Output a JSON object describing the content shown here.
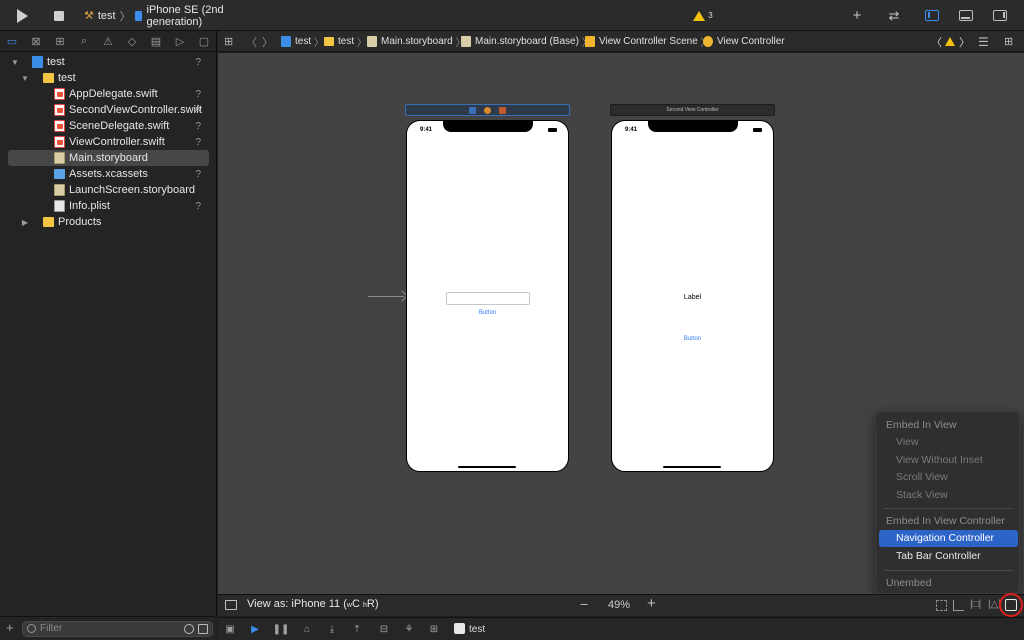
{
  "toolbar": {
    "scheme": "test",
    "destination": "iPhone SE (2nd generation)",
    "warning_count": "3",
    "icons": [
      "play-icon",
      "stop-icon",
      "hammer-icon",
      "plus-icon",
      "swap-icon",
      "navigator-toggle-icon",
      "debug-area-toggle-icon",
      "inspector-toggle-icon"
    ]
  },
  "navigator": {
    "tree": [
      {
        "label": "test",
        "badge": "?"
      },
      {
        "label": "test",
        "badge": ""
      },
      {
        "label": "AppDelegate.swift",
        "badge": "?"
      },
      {
        "label": "SecondViewController.swift",
        "badge": "A"
      },
      {
        "label": "SceneDelegate.swift",
        "badge": "?"
      },
      {
        "label": "ViewController.swift",
        "badge": "?"
      },
      {
        "label": "Main.storyboard",
        "badge": ""
      },
      {
        "label": "Assets.xcassets",
        "badge": "?"
      },
      {
        "label": "LaunchScreen.storyboard",
        "badge": ""
      },
      {
        "label": "Info.plist",
        "badge": "?"
      },
      {
        "label": "Products",
        "badge": ""
      }
    ],
    "filter_placeholder": "Filter"
  },
  "jumpbar": {
    "crumbs": [
      "test",
      "test",
      "Main.storyboard",
      "Main.storyboard (Base)",
      "View Controller Scene",
      "View Controller"
    ]
  },
  "canvas": {
    "scene1": {
      "time": "9:41",
      "button": "Button"
    },
    "scene2": {
      "title": "Second View Controller",
      "time": "9:41",
      "label": "Label",
      "button": "Button"
    }
  },
  "embed_menu": {
    "header_view": "Embed In View",
    "view_items": [
      "View",
      "View Without Inset",
      "Scroll View",
      "Stack View"
    ],
    "header_vc": "Embed In View Controller",
    "vc_items": [
      "Navigation Controller",
      "Tab Bar Controller"
    ],
    "unembed": "Unembed"
  },
  "canvas_bottom": {
    "view_as": "View as: iPhone 11 (",
    "size_w": "w",
    "size_c": "C",
    "size_h": "h",
    "size_r": "R)",
    "zoom": "49%"
  },
  "debug_bar": {
    "process": "test"
  },
  "colors": {
    "accent": "#2d64c8",
    "warning": "#f4c20d",
    "highlight_circle": "#e0201b"
  }
}
